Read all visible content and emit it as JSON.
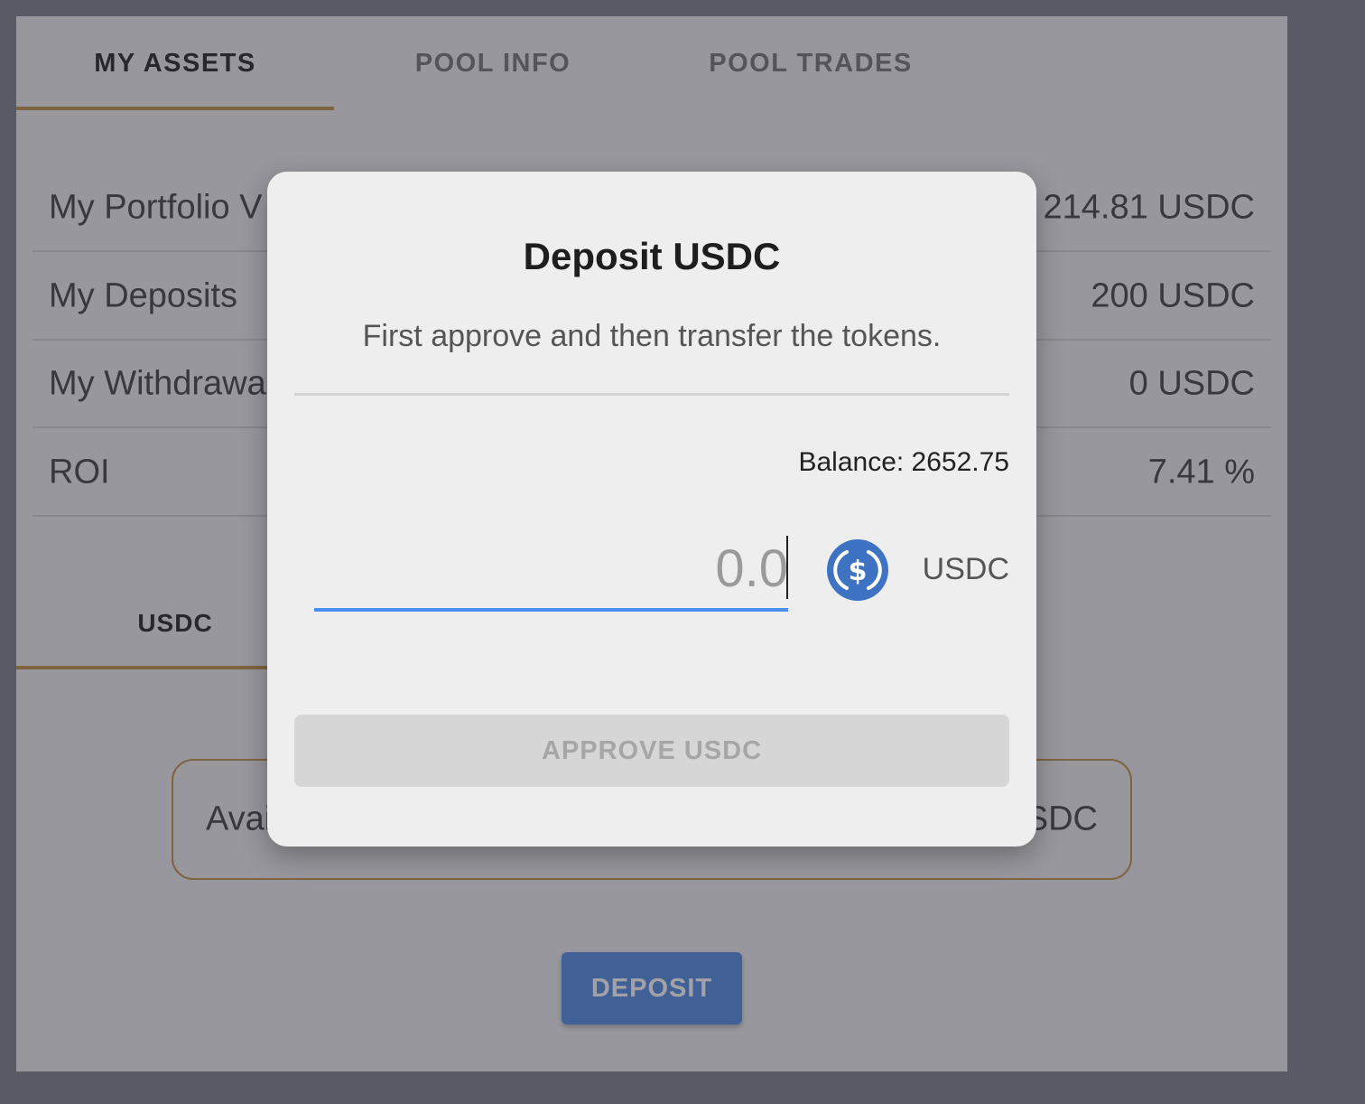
{
  "tabs": [
    {
      "label": "MY ASSETS",
      "active": true
    },
    {
      "label": "POOL INFO",
      "active": false
    },
    {
      "label": "POOL TRADES",
      "active": false
    }
  ],
  "stats": [
    {
      "label": "My Portfolio V",
      "value": "214.81 USDC"
    },
    {
      "label": "My Deposits",
      "value": "200 USDC"
    },
    {
      "label": "My Withdrawa",
      "value": "0 USDC"
    },
    {
      "label": "ROI",
      "value": "7.41 %"
    }
  ],
  "asset_tab": {
    "label": "USDC"
  },
  "available": {
    "label": "Avai",
    "value": "SDC"
  },
  "deposit_button": {
    "label": "DEPOSIT"
  },
  "modal": {
    "title": "Deposit USDC",
    "subtitle": "First approve and then transfer the tokens.",
    "balance_text": "Balance: 2652.75",
    "amount_placeholder": "0.0",
    "amount_value": "",
    "currency": "USDC",
    "approve_label": "APPROVE USDC"
  },
  "colors": {
    "accent": "#c4964f",
    "primary": "#5a8fe0",
    "usdc": "#3e73c4",
    "input_underline": "#4a8ff0"
  },
  "icons": {
    "currency": "usdc-icon"
  }
}
